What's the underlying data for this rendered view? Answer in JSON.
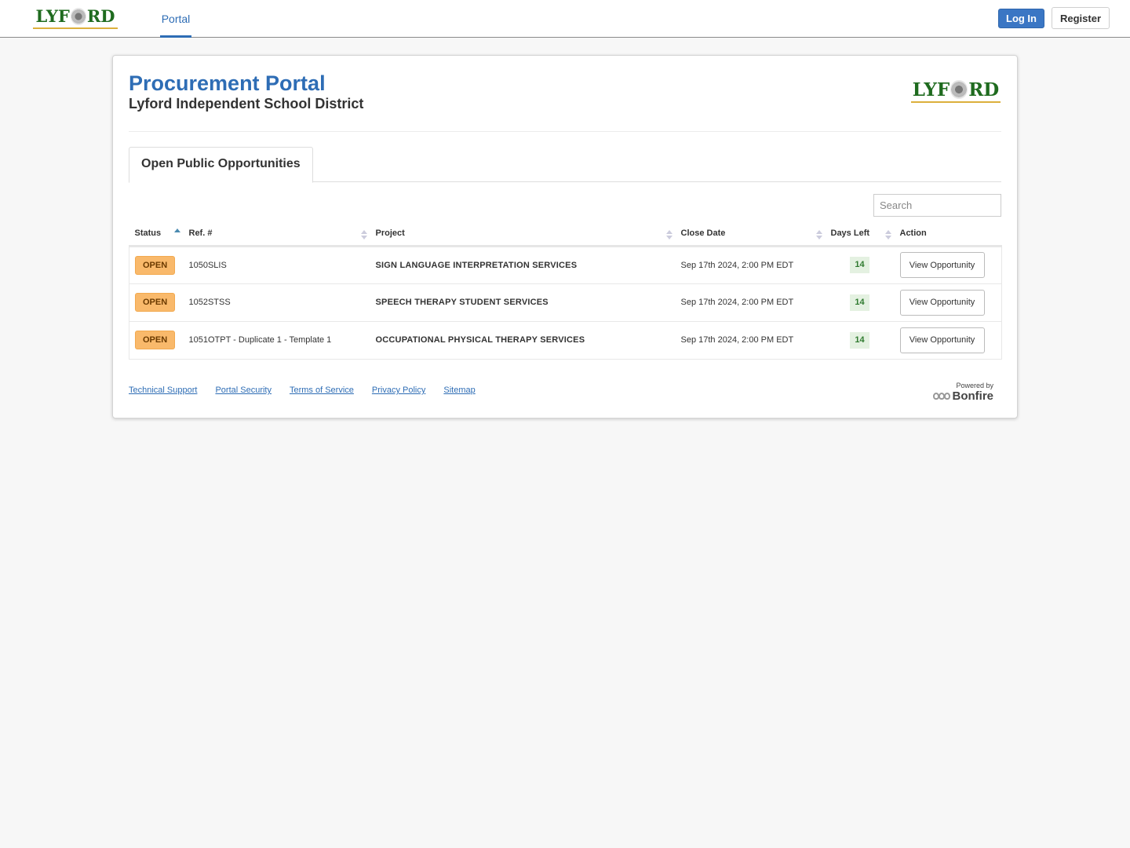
{
  "topbar": {
    "logo_text": [
      "LYF",
      "RD"
    ],
    "nav": [
      {
        "label": "Portal",
        "active": true
      }
    ],
    "login_label": "Log In",
    "register_label": "Register"
  },
  "header": {
    "title": "Procurement Portal",
    "subtitle": "Lyford Independent School District",
    "logo_text": [
      "LYF",
      "RD"
    ]
  },
  "tabs": [
    {
      "label": "Open Public Opportunities",
      "active": true
    }
  ],
  "search": {
    "placeholder": "Search",
    "value": ""
  },
  "table": {
    "columns": [
      {
        "label": "Status",
        "sort": "asc"
      },
      {
        "label": "Ref. #",
        "sort": "none"
      },
      {
        "label": "Project",
        "sort": "none"
      },
      {
        "label": "Close Date",
        "sort": "none"
      },
      {
        "label": "Days Left",
        "sort": "none"
      },
      {
        "label": "Action",
        "sort": null
      }
    ],
    "rows": [
      {
        "status": "OPEN",
        "ref": "1050SLIS",
        "project": "SIGN LANGUAGE INTERPRETATION SERVICES",
        "close_date": "Sep 17th 2024, 2:00 PM EDT",
        "days_left": "14",
        "action": "View Opportunity"
      },
      {
        "status": "OPEN",
        "ref": "1052STSS",
        "project": "SPEECH THERAPY STUDENT SERVICES",
        "close_date": "Sep 17th 2024, 2:00 PM EDT",
        "days_left": "14",
        "action": "View Opportunity"
      },
      {
        "status": "OPEN",
        "ref": "1051OTPT - Duplicate 1 - Template 1",
        "project": "OCCUPATIONAL PHYSICAL THERAPY SERVICES",
        "close_date": "Sep 17th 2024, 2:00 PM EDT",
        "days_left": "14",
        "action": "View Opportunity"
      }
    ]
  },
  "footer": {
    "links": [
      "Technical Support",
      "Portal Security",
      "Terms of Service",
      "Privacy Policy",
      "Sitemap"
    ],
    "powered_by": "Powered by",
    "brand": "Bonfire"
  },
  "colors": {
    "accent": "#2e6db5",
    "login_button": "#3a76c4",
    "status_open": "#f9b96b",
    "days_left_bg": "#e4f1e1",
    "logo_green": "#1f6b1f"
  }
}
